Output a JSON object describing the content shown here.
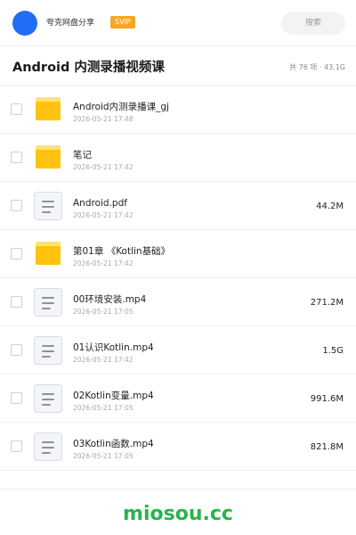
{
  "topbar": {
    "share_name": "夸克网盘分享",
    "badge": "SVIP",
    "search_placeholder": "搜索",
    "avatar_color": "#1f6ef5",
    "badge_color": "#f5a623"
  },
  "header": {
    "title": "Android 内测录播视频课",
    "summary": "共 76 项 · 43.1G"
  },
  "files": [
    {
      "icon": "folder-icon",
      "name": "Android内测录播课_gj",
      "date": "2026-05-21 17:48",
      "size": ""
    },
    {
      "icon": "folder-icon",
      "name": "笔记",
      "date": "2026-05-21 17:42",
      "size": ""
    },
    {
      "icon": "document-icon",
      "name": "Android.pdf",
      "date": "2026-05-21 17:42",
      "size": "44.2M"
    },
    {
      "icon": "folder-icon",
      "name": "第01章 《Kotlin基础》",
      "date": "2026-05-21 17:42",
      "size": ""
    },
    {
      "icon": "document-icon",
      "name": "00环境安装.mp4",
      "date": "2026-05-21 17:05",
      "size": "271.2M"
    },
    {
      "icon": "document-icon",
      "name": "01认识Kotlin.mp4",
      "date": "2026-05-21 17:42",
      "size": "1.5G"
    },
    {
      "icon": "document-icon",
      "name": "02Kotlin变量.mp4",
      "date": "2026-05-21 17:05",
      "size": "991.6M"
    },
    {
      "icon": "document-icon",
      "name": "03Kotlin函数.mp4",
      "date": "2026-05-21 17:05",
      "size": "821.8M"
    }
  ],
  "footer": {
    "watermark": "miosou.cc",
    "watermark_color": "#2bb24c"
  }
}
